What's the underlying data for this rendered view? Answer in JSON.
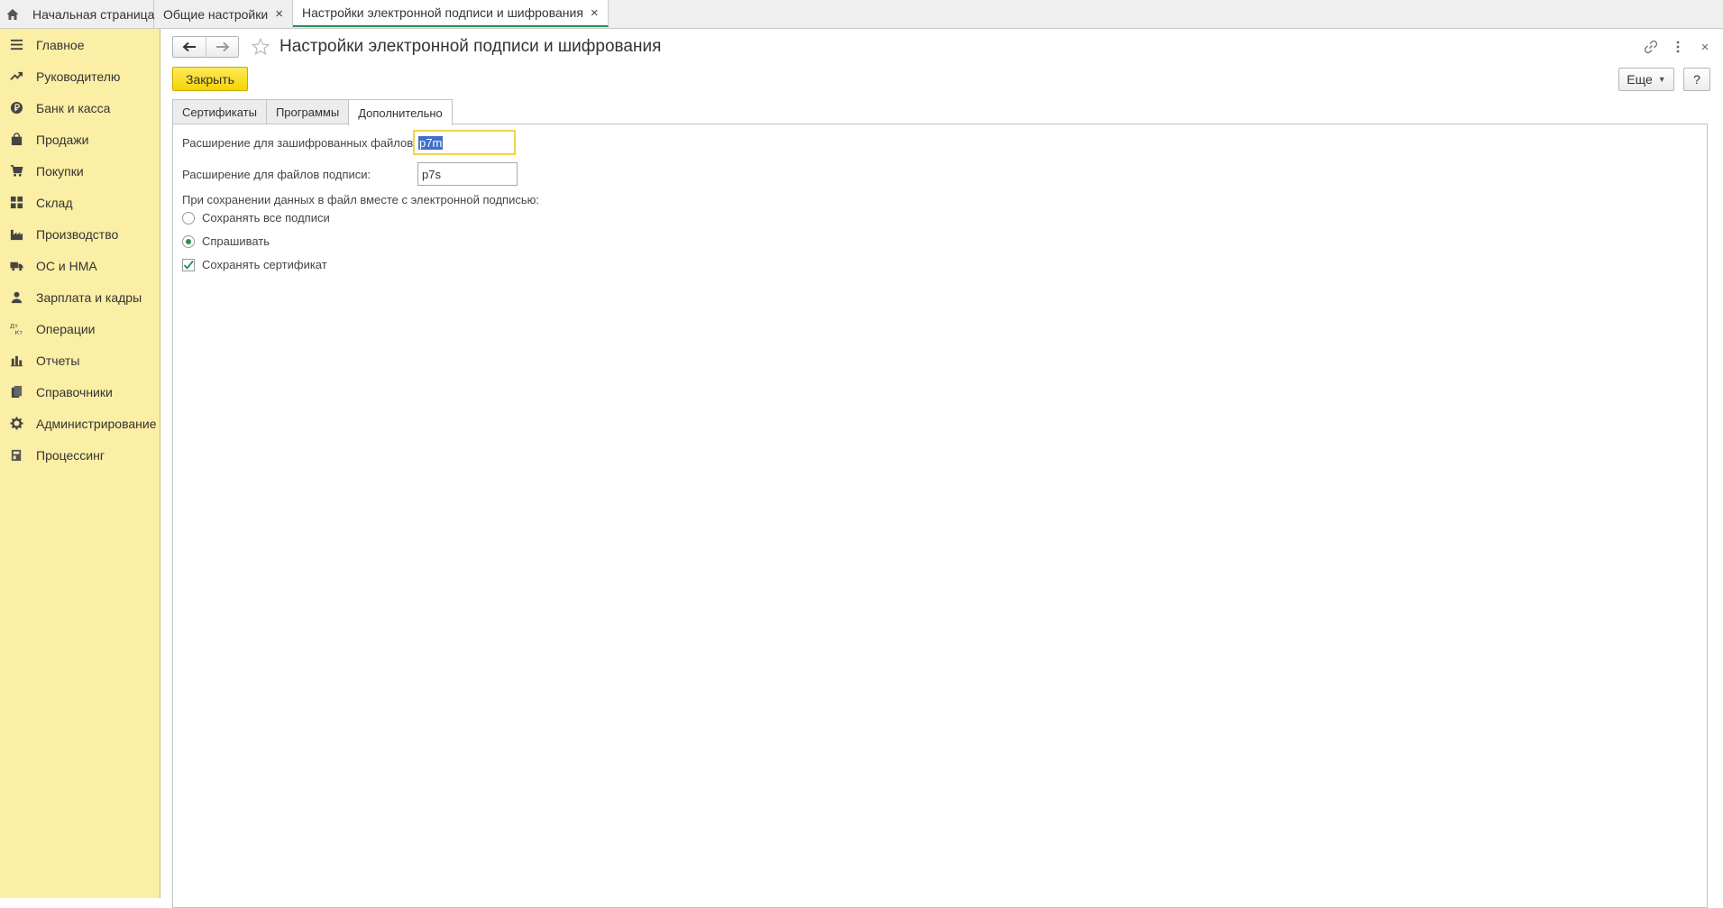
{
  "top_tabs": [
    {
      "label": "Начальная страница",
      "icon": "home-icon"
    },
    {
      "label": "Общие настройки",
      "closable": true
    },
    {
      "label": "Настройки электронной подписи и шифрования",
      "closable": true,
      "active": true
    }
  ],
  "close_glyph": "×",
  "sidebar": {
    "items": [
      {
        "label": "Главное",
        "icon": "menu-icon"
      },
      {
        "label": "Руководителю",
        "icon": "trend-icon"
      },
      {
        "label": "Банк и касса",
        "icon": "ruble-icon"
      },
      {
        "label": "Продажи",
        "icon": "bag-icon"
      },
      {
        "label": "Покупки",
        "icon": "cart-icon"
      },
      {
        "label": "Склад",
        "icon": "grid-icon"
      },
      {
        "label": "Производство",
        "icon": "factory-icon"
      },
      {
        "label": "ОС и НМА",
        "icon": "truck-icon"
      },
      {
        "label": "Зарплата и кадры",
        "icon": "person-icon"
      },
      {
        "label": "Операции",
        "icon": "dt-kt-icon"
      },
      {
        "label": "Отчеты",
        "icon": "bar-chart-icon"
      },
      {
        "label": "Справочники",
        "icon": "books-icon"
      },
      {
        "label": "Администрирование",
        "icon": "gear-icon"
      },
      {
        "label": "Процессинг",
        "icon": "processing-icon"
      }
    ]
  },
  "header": {
    "title": "Настройки электронной подписи и шифрования",
    "close_button": "Закрыть",
    "more_button": "Еще",
    "help_button": "?",
    "window_close": "×"
  },
  "form_tabs": [
    {
      "label": "Сертификаты"
    },
    {
      "label": "Программы"
    },
    {
      "label": "Дополнительно",
      "active": true
    }
  ],
  "form": {
    "encrypted_ext_label": "Расширение для зашифрованных файлов:",
    "encrypted_ext_value": "p7m",
    "signature_ext_label": "Расширение для файлов подписи:",
    "signature_ext_value": "p7s",
    "save_caption": "При сохранении данных в файл вместе с электронной подписью:",
    "radio_options": [
      {
        "label": "Сохранять все подписи",
        "selected": false
      },
      {
        "label": "Спрашивать",
        "selected": true
      }
    ],
    "save_certificate_label": "Сохранять сертификат",
    "save_certificate_checked": true
  },
  "colors": {
    "sidebar_bg": "#fbeea5",
    "accent_yellow": "#f6d400",
    "active_green": "#2e8b57",
    "selection_blue": "#3f6fc9"
  }
}
